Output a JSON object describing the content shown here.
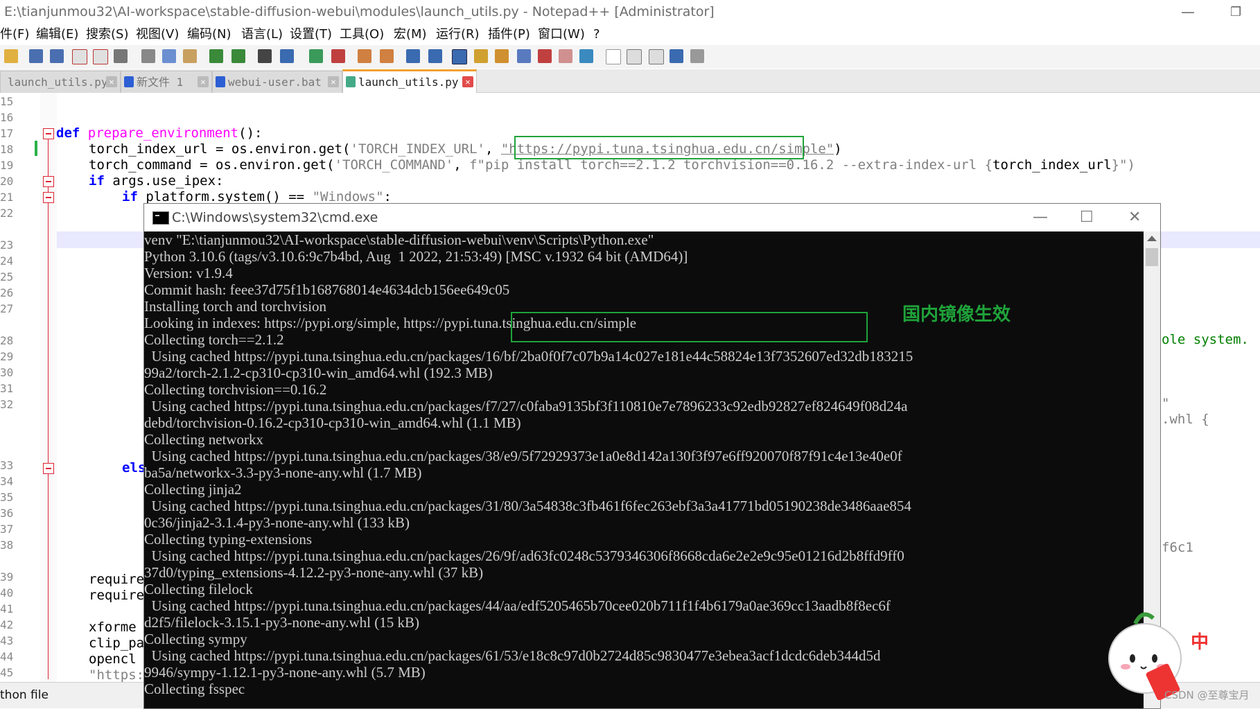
{
  "window": {
    "title": "E:\\tianjunmou32\\AI-workspace\\stable-diffusion-webui\\modules\\launch_utils.py - Notepad++ [Administrator]",
    "min_glyph": "—",
    "max_glyph": "❐"
  },
  "menu": [
    "件(F)",
    "编辑(E)",
    "搜索(S)",
    "视图(V)",
    "编码(N)",
    "语言(L)",
    "设置(T)",
    "工具(O)",
    "宏(M)",
    "运行(R)",
    "插件(P)",
    "窗口(W)",
    "?"
  ],
  "tabs": [
    {
      "label": "launch_utils.py",
      "active": false
    },
    {
      "label": "新文件  1",
      "active": false
    },
    {
      "label": "webui-user.bat",
      "active": false
    },
    {
      "label": "launch_utils.py",
      "active": true
    }
  ],
  "editor": {
    "line_numbers": [
      "15",
      "16",
      "17",
      "18",
      "19",
      "20",
      "21",
      "22",
      "23",
      "24",
      "25",
      "26",
      "27",
      "28",
      "29",
      "30",
      "31",
      "32",
      "33",
      "34",
      "35",
      "36",
      "37",
      "38",
      "39",
      "40",
      "41",
      "42",
      "43",
      "44",
      "45"
    ],
    "code": {
      "def_kw": "def",
      "func_name": "prepare_environment",
      "def_tail": "():",
      "l18_left": "torch_index_url = os.environ.get(",
      "l18_key": "'TORCH_INDEX_URL'",
      "l18_comma": ", ",
      "l18_url": "\"https://pypi.tuna.tsinghua.edu.cn/simple\"",
      "l18_close": ")",
      "l19_left": "torch_command = os.environ.get(",
      "l19_key": "'TORCH_COMMAND'",
      "l19_comma": ", ",
      "l19_str": "f\"pip install torch==2.1.2 torchvision==0.16.2 --extra-index-url {",
      "l19_var": "torch_index_url",
      "l19_end": "}\")",
      "l20_if": "if",
      "l20_rest": " args.use_ipex:",
      "l21_if": "if",
      "l21_rest": " platform.system() == ",
      "l21_str": "\"Windows\"",
      "l21_colon": ":",
      "else_frag": "els",
      "req1": "require",
      "req2": "require",
      "xformers": "xforme",
      "clip": "clip_pa",
      "opencl": "opencl",
      "https_frag": "\"https:",
      "right1": "ole system.",
      "right2": "\"",
      "right3": ".whl {",
      "right4": "f6c1"
    }
  },
  "statusbar": {
    "file_type": "thon file"
  },
  "cmd": {
    "title": "C:\\Windows\\system32\\cmd.exe",
    "min_glyph": "—",
    "max_glyph": "☐",
    "close_glyph": "✕",
    "lines": [
      "venv \"E:\\tianjunmou32\\AI-workspace\\stable-diffusion-webui\\venv\\Scripts\\Python.exe\"",
      "Python 3.10.6 (tags/v3.10.6:9c7b4bd, Aug  1 2022, 21:53:49) [MSC v.1932 64 bit (AMD64)]",
      "Version: v1.9.4",
      "Commit hash: feee37d75f1b168768014e4634dcb156ee649c05",
      "Installing torch and torchvision",
      "Looking in indexes: https://pypi.org/simple, https://pypi.tuna.tsinghua.edu.cn/simple",
      "Collecting torch==2.1.2",
      "  Using cached https://pypi.tuna.tsinghua.edu.cn/packages/16/bf/2ba0f0f7c07b9a14c027e181e44c58824e13f7352607ed32db183215",
      "99a2/torch-2.1.2-cp310-cp310-win_amd64.whl (192.3 MB)",
      "Collecting torchvision==0.16.2",
      "  Using cached https://pypi.tuna.tsinghua.edu.cn/packages/f7/27/c0faba9135bf3f110810e7e7896233c92edb92827ef824649f08d24a",
      "debd/torchvision-0.16.2-cp310-cp310-win_amd64.whl (1.1 MB)",
      "Collecting networkx",
      "  Using cached https://pypi.tuna.tsinghua.edu.cn/packages/38/e9/5f72929373e1a0e8d142a130f3f97e6ff920070f87f91c4e13e40e0f",
      "ba5a/networkx-3.3-py3-none-any.whl (1.7 MB)",
      "Collecting jinja2",
      "  Using cached https://pypi.tuna.tsinghua.edu.cn/packages/31/80/3a54838c3fb461f6fec263ebf3a3a41771bd05190238de3486aae854",
      "0c36/jinja2-3.1.4-py3-none-any.whl (133 kB)",
      "Collecting typing-extensions",
      "  Using cached https://pypi.tuna.tsinghua.edu.cn/packages/26/9f/ad63fc0248c5379346306f8668cda6e2e2e9c95e01216d2b8ffd9ff0",
      "37d0/typing_extensions-4.12.2-py3-none-any.whl (37 kB)",
      "Collecting filelock",
      "  Using cached https://pypi.tuna.tsinghua.edu.cn/packages/44/aa/edf5205465b70cee020b711f1f4b6179a0ae369cc13aadb8f8ec6f",
      "d2f5/filelock-3.15.1-py3-none-any.whl (15 kB)",
      "Collecting sympy",
      "  Using cached https://pypi.tuna.tsinghua.edu.cn/packages/61/53/e18c8c97d0b2724d85c9830477e3ebea3acf1dcdc6deb344d5d",
      "9946/sympy-1.12.1-py3-none-any.whl (5.7 MB)",
      "Collecting fsspec"
    ]
  },
  "annotation": "国内镜像生效",
  "watermark": "CSDN @至尊宝月",
  "mascot_glyph": "中",
  "colors": {
    "highlight_box": "#1fa33a",
    "console_bg": "#0c0c0c",
    "console_text": "#cccccc"
  }
}
